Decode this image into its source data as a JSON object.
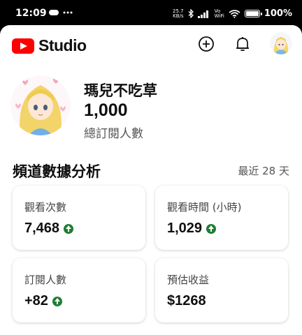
{
  "status_bar": {
    "time": "12:09",
    "net_speed_value": "25.7",
    "net_speed_unit": "KB/s",
    "vo_label": "Vo",
    "wifi_label": "WiFi",
    "battery_percent": "100%"
  },
  "header": {
    "logo_text": "Studio",
    "icons": [
      "youtube-logo",
      "create-icon",
      "bell-icon",
      "avatar"
    ]
  },
  "channel": {
    "name": "瑪兒不吃草",
    "subscriber_count": "1,000",
    "subscriber_label": "總訂閱人數"
  },
  "analytics": {
    "title": "頻道數據分析",
    "range": "最近 28 天",
    "cards": [
      {
        "label": "觀看次數",
        "value": "7,468",
        "trend": "up"
      },
      {
        "label": "觀看時間 (小時)",
        "value": "1,029",
        "trend": "up"
      },
      {
        "label": "訂閱人數",
        "value": "+82",
        "trend": "up"
      },
      {
        "label": "預估收益",
        "value": "$1268",
        "trend": "none"
      }
    ]
  },
  "colors": {
    "brand_red": "#ff0000",
    "trend_up_green": "#1e7e34"
  }
}
